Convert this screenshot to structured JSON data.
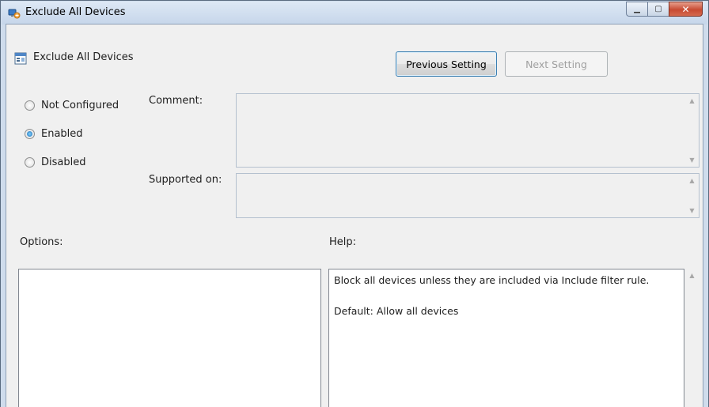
{
  "window": {
    "title": "Exclude All Devices",
    "minimize_glyph": "▁",
    "maximize_glyph": "▢",
    "close_glyph": "✕"
  },
  "setting": {
    "name": "Exclude All Devices"
  },
  "nav": {
    "previous_label": "Previous Setting",
    "next_label": "Next Setting",
    "next_enabled": false
  },
  "state": {
    "options": [
      {
        "label": "Not Configured",
        "selected": false
      },
      {
        "label": "Enabled",
        "selected": true
      },
      {
        "label": "Disabled",
        "selected": false
      }
    ]
  },
  "comment": {
    "label": "Comment:",
    "value": ""
  },
  "supported_on": {
    "label": "Supported on:",
    "value": ""
  },
  "options_section": {
    "label": "Options:"
  },
  "help_section": {
    "label": "Help:",
    "lines": [
      "Block all devices unless they are included via Include filter rule.",
      "Default: Allow all devices"
    ]
  },
  "colors": {
    "accent": "#3c7fb1",
    "close_button": "#c74a32",
    "dialog_background": "#f0f0f0"
  },
  "icons": {
    "title_icon": "device-install-icon",
    "setting_icon": "policy-setting-icon",
    "scroll_up": "▲",
    "scroll_down": "▼"
  }
}
